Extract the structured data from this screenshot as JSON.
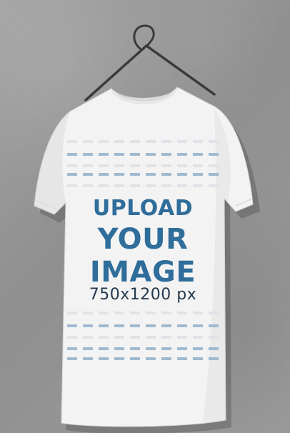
{
  "mockup": {
    "line1": "UPLOAD",
    "line2": "YOUR",
    "line3": "IMAGE",
    "dimensions": "750x1200 px"
  },
  "colors": {
    "wall": "#9a9a9a",
    "shirt": "#f2f2f2",
    "text_primary": "#2f6d9a",
    "text_secondary": "#243a4e",
    "dash": "#9fbad0"
  }
}
